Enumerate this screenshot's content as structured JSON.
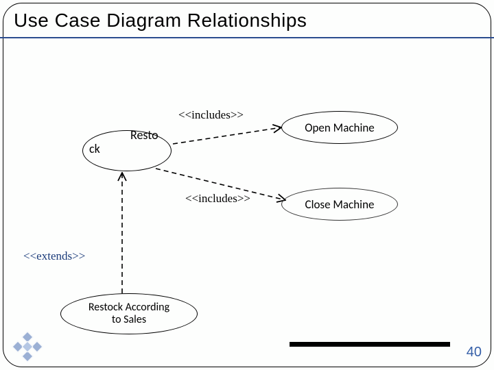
{
  "title": "Use Case Diagram Relationships",
  "usecases": {
    "restock": {
      "line1": "Resto",
      "line2": "ck"
    },
    "open_machine": "Open Machine",
    "close_machine": "Close Machine",
    "restock_sales_line1": "Restock According",
    "restock_sales_line2": "to Sales"
  },
  "stereotypes": {
    "includes1": "<<includes>>",
    "includes2": "<<includes>>",
    "extends": "<<extends>>"
  },
  "page_number": "40"
}
